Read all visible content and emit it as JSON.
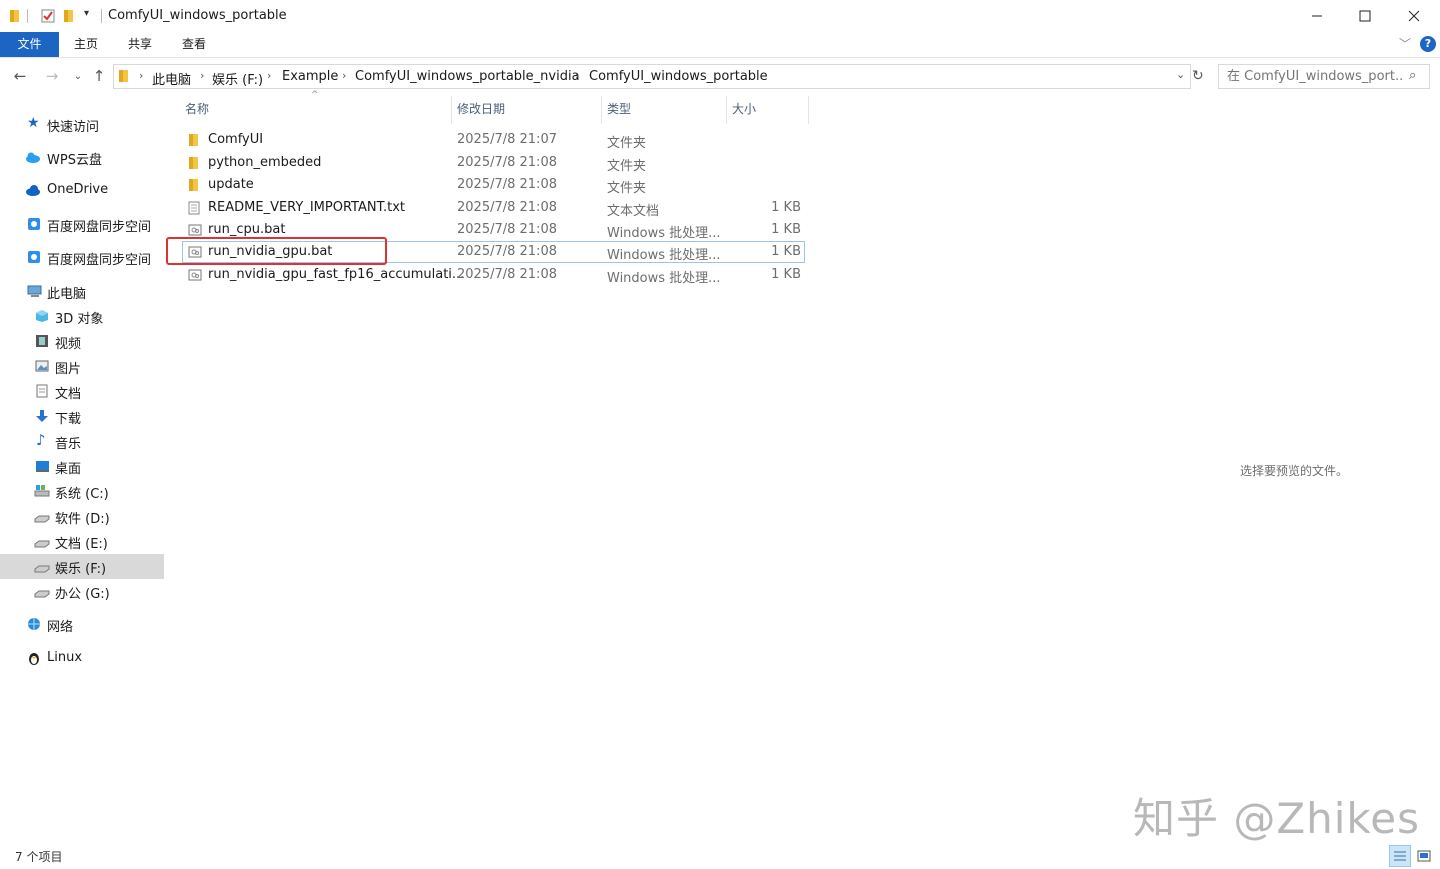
{
  "window": {
    "title": "ComfyUI_windows_portable"
  },
  "ribbon": {
    "tabs": [
      "文件",
      "主页",
      "共享",
      "查看"
    ]
  },
  "address": {
    "crumbs": [
      "此电脑",
      "娱乐 (F:)",
      "Example",
      "ComfyUI_windows_portable_nvidia",
      "ComfyUI_windows_portable"
    ]
  },
  "search": {
    "placeholder": "在 ComfyUI_windows_port..."
  },
  "sidebar": {
    "items": [
      {
        "label": "快速访问",
        "icon": "star-icon"
      },
      {
        "label": "WPS云盘",
        "icon": "cloud-icon"
      },
      {
        "label": "OneDrive",
        "icon": "onedrive-cloud-icon"
      },
      {
        "label": "百度网盘同步空间",
        "icon": "baidu-sync-icon"
      },
      {
        "label": "百度网盘同步空间",
        "icon": "baidu-sync-icon"
      },
      {
        "label": "此电脑",
        "icon": "computer-icon"
      },
      {
        "label": "3D 对象",
        "icon": "cube-icon"
      },
      {
        "label": "视频",
        "icon": "film-icon"
      },
      {
        "label": "图片",
        "icon": "picture-icon"
      },
      {
        "label": "文档",
        "icon": "document-icon"
      },
      {
        "label": "下载",
        "icon": "download-arrow-icon"
      },
      {
        "label": "音乐",
        "icon": "music-note-icon"
      },
      {
        "label": "桌面",
        "icon": "desktop-icon"
      },
      {
        "label": "系统 (C:)",
        "icon": "system-drive-icon"
      },
      {
        "label": "软件 (D:)",
        "icon": "drive-icon"
      },
      {
        "label": "文档 (E:)",
        "icon": "drive-icon"
      },
      {
        "label": "娱乐 (F:)",
        "icon": "drive-icon"
      },
      {
        "label": "办公 (G:)",
        "icon": "drive-icon"
      },
      {
        "label": "网络",
        "icon": "network-icon"
      },
      {
        "label": "Linux",
        "icon": "penguin-icon"
      }
    ],
    "selected": "娱乐 (F:)"
  },
  "list": {
    "columns": [
      "名称",
      "修改日期",
      "类型",
      "大小"
    ],
    "rows": [
      {
        "name": "ComfyUI",
        "date": "2025/7/8 21:07",
        "type": "文件夹",
        "size": "",
        "icon": "folder-icon"
      },
      {
        "name": "python_embeded",
        "date": "2025/7/8 21:08",
        "type": "文件夹",
        "size": "",
        "icon": "folder-icon"
      },
      {
        "name": "update",
        "date": "2025/7/8 21:08",
        "type": "文件夹",
        "size": "",
        "icon": "folder-icon"
      },
      {
        "name": "README_VERY_IMPORTANT.txt",
        "date": "2025/7/8 21:08",
        "type": "文本文档",
        "size": "1 KB",
        "icon": "text-file-icon"
      },
      {
        "name": "run_cpu.bat",
        "date": "2025/7/8 21:08",
        "type": "Windows 批处理...",
        "size": "1 KB",
        "icon": "batch-file-icon"
      },
      {
        "name": "run_nvidia_gpu.bat",
        "date": "2025/7/8 21:08",
        "type": "Windows 批处理...",
        "size": "1 KB",
        "icon": "batch-file-icon"
      },
      {
        "name": "run_nvidia_gpu_fast_fp16_accumulati...",
        "date": "2025/7/8 21:08",
        "type": "Windows 批处理...",
        "size": "1 KB",
        "icon": "batch-file-icon"
      }
    ],
    "highlighted": "run_nvidia_gpu.bat"
  },
  "preview": {
    "text": "选择要预览的文件。"
  },
  "status": {
    "count": "7 个项目"
  },
  "watermark": {
    "text": "知乎 @Zhikes"
  },
  "colors": {
    "accent": "#1c65c2",
    "highlight_box": "#e03131",
    "selected_bg": "#d9d9d9"
  }
}
